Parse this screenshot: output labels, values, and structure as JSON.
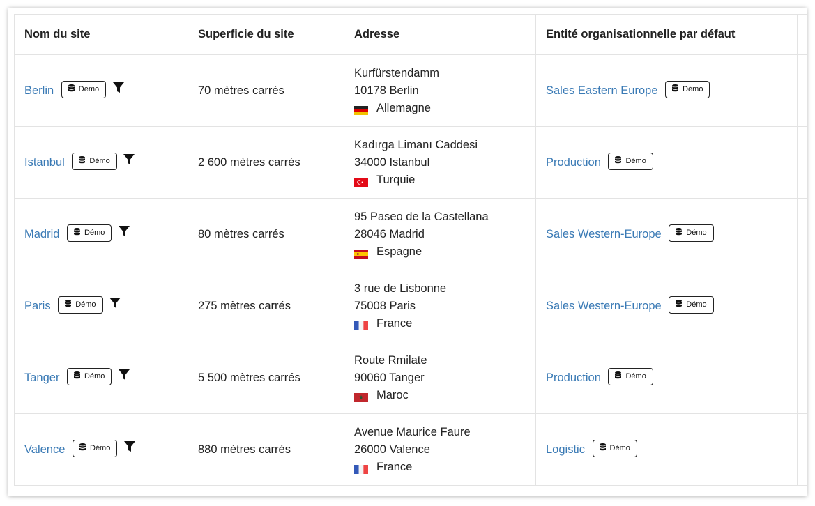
{
  "headers": {
    "site_name": "Nom du site",
    "site_area": "Superficie du site",
    "address": "Adresse",
    "default_org_entity": "Entité organisationnelle par défaut"
  },
  "rows": [
    {
      "name": "Berlin",
      "badge": "Démo",
      "area": "70 mètres carrés",
      "street": "Kurfürstendamm",
      "city": "10178 Berlin",
      "country": "Allemagne",
      "flag": "germany",
      "entity": "Sales Eastern Europe",
      "entity_badge": "Démo"
    },
    {
      "name": "Istanbul",
      "badge": "Démo",
      "area": "2 600 mètres carrés",
      "street": "Kadırga Limanı Caddesi",
      "city": "34000 Istanbul",
      "country": "Turquie",
      "flag": "turkey",
      "entity": "Production",
      "entity_badge": "Démo"
    },
    {
      "name": "Madrid",
      "badge": "Démo",
      "area": "80 mètres carrés",
      "street": "95 Paseo de la Castellana",
      "city": "28046 Madrid",
      "country": "Espagne",
      "flag": "spain",
      "entity": "Sales Western-Europe",
      "entity_badge": "Démo"
    },
    {
      "name": "Paris",
      "badge": "Démo",
      "area": "275 mètres carrés",
      "street": "3 rue de Lisbonne",
      "city": "75008 Paris",
      "country": "France",
      "flag": "france",
      "entity": "Sales Western-Europe",
      "entity_badge": "Démo"
    },
    {
      "name": "Tanger",
      "badge": "Démo",
      "area": "5 500 mètres carrés",
      "street": "Route Rmilate",
      "city": "90060 Tanger",
      "country": "Maroc",
      "flag": "morocco",
      "entity": "Production",
      "entity_badge": "Démo"
    },
    {
      "name": "Valence",
      "badge": "Démo",
      "area": "880 mètres carrés",
      "street": "Avenue Maurice Faure",
      "city": "26000 Valence",
      "country": "France",
      "flag": "france",
      "entity": "Logistic",
      "entity_badge": "Démo"
    }
  ],
  "colors": {
    "link": "#3a7ab5",
    "border": "#e3e3e3"
  }
}
